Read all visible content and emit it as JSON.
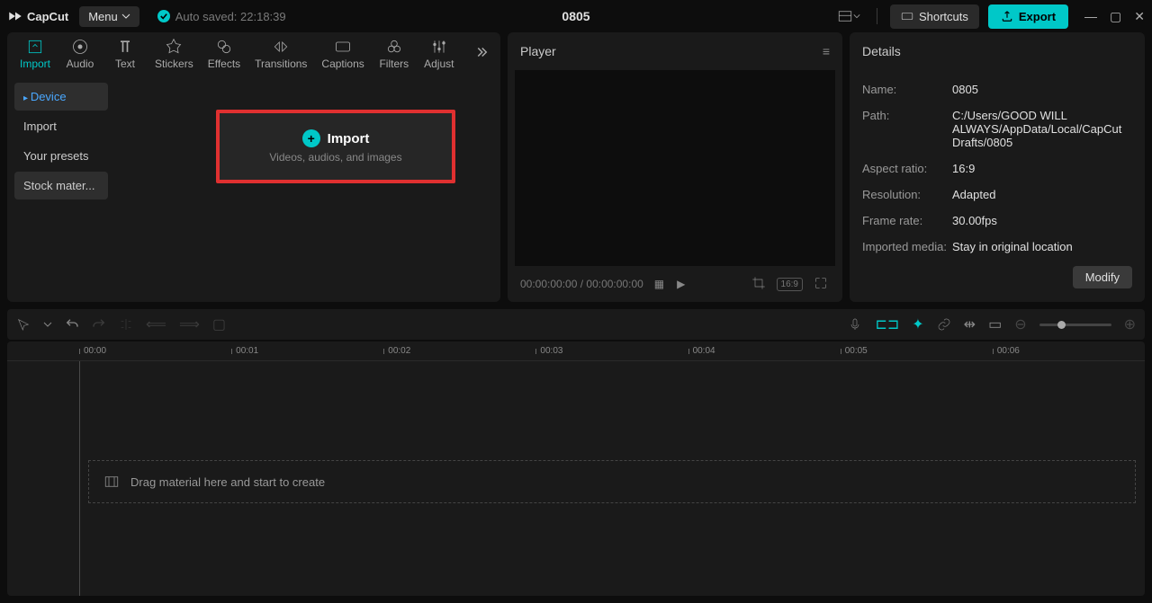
{
  "app": {
    "name": "CapCut",
    "menu_label": "Menu",
    "auto_saved": "Auto saved: 22:18:39",
    "project_title": "0805"
  },
  "titlebar": {
    "shortcuts": "Shortcuts",
    "export": "Export"
  },
  "tabs": [
    "Import",
    "Audio",
    "Text",
    "Stickers",
    "Effects",
    "Transitions",
    "Captions",
    "Filters",
    "Adjust"
  ],
  "sidebar": {
    "device": "Device",
    "import": "Import",
    "presets": "Your presets",
    "stock": "Stock mater..."
  },
  "import_box": {
    "label": "Import",
    "hint": "Videos, audios, and images"
  },
  "player": {
    "title": "Player",
    "time": "00:00:00:00 / 00:00:00:00",
    "ratio": "16:9"
  },
  "details": {
    "title": "Details",
    "name_label": "Name:",
    "name_value": "0805",
    "path_label": "Path:",
    "path_value": "C:/Users/GOOD WILL ALWAYS/AppData/Local/CapCut Drafts/0805",
    "aspect_label": "Aspect ratio:",
    "aspect_value": "16:9",
    "resolution_label": "Resolution:",
    "resolution_value": "Adapted",
    "framerate_label": "Frame rate:",
    "framerate_value": "30.00fps",
    "imported_label": "Imported media:",
    "imported_value": "Stay in original location",
    "modify": "Modify"
  },
  "timeline": {
    "marks": [
      "00:00",
      "00:01",
      "00:02",
      "00:03",
      "00:04",
      "00:05",
      "00:06"
    ],
    "drop_hint": "Drag material here and start to create"
  }
}
